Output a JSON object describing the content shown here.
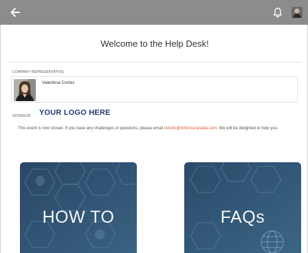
{
  "topbar": {
    "back_icon": "arrow-left-icon",
    "bell_icon": "bell-icon",
    "profile_icon": "profile-icon"
  },
  "page": {
    "title": "Welcome to the Help Desk!"
  },
  "representative": {
    "section_label": "COMPANY REPRESENTATIVE",
    "name": "Valentina Cortes"
  },
  "sponsor": {
    "section_label": "SPONSOR",
    "logo_text": "YOUR LOGO HERE"
  },
  "notice": {
    "text_before": "This event is now closed. If you have any challenges or questions, please email ",
    "email": "events@informacanada.com",
    "text_after": ". We will be delighted to help you."
  },
  "tiles": [
    {
      "label": "HOW TO",
      "icon": "howto-tile"
    },
    {
      "label": "FAQs",
      "icon": "faqs-tile"
    }
  ],
  "colors": {
    "topbar": "#8c8c8c",
    "tile": "#2e4f6f",
    "email_link": "#e05a2b",
    "logo": "#1f3b74"
  }
}
